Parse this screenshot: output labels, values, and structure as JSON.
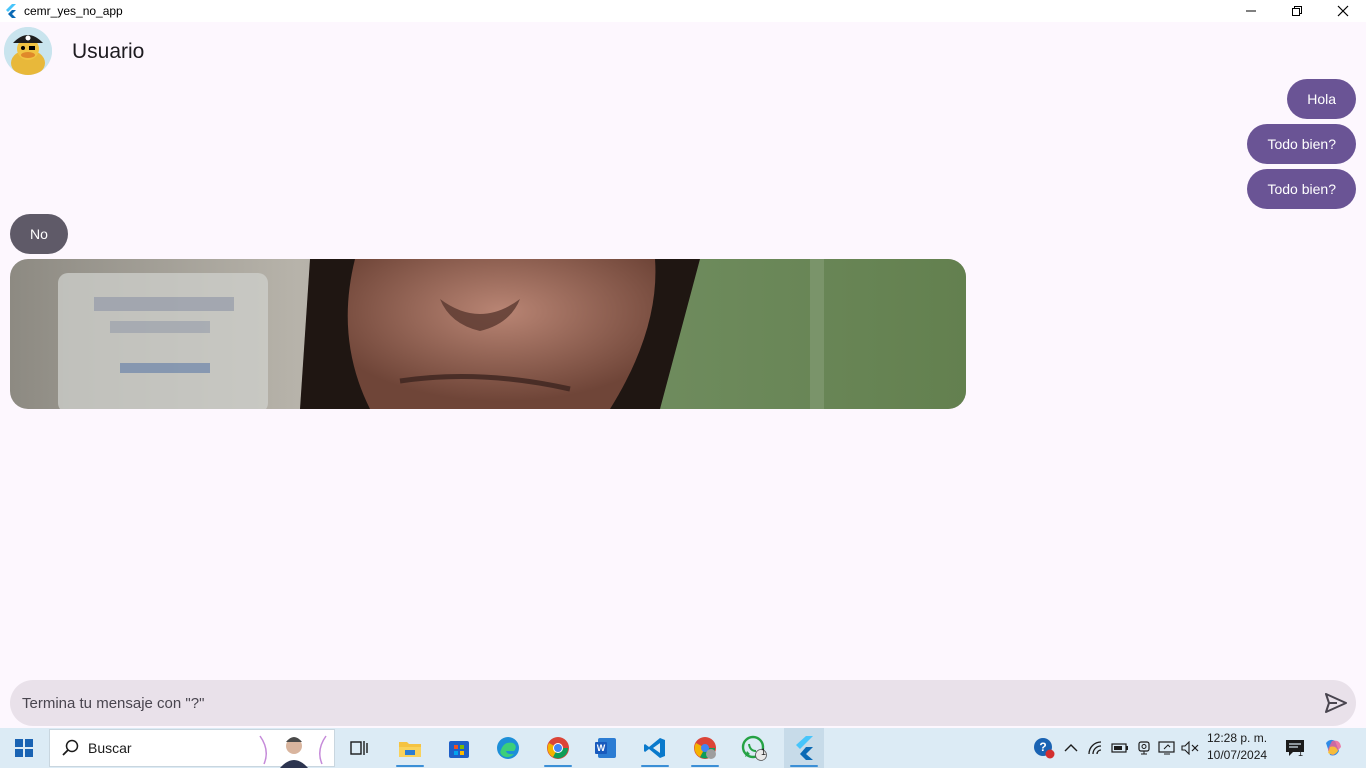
{
  "window": {
    "title": "cemr_yes_no_app",
    "icon": "flutter-logo-icon",
    "controls": [
      "minimize-icon",
      "restore-icon",
      "close-icon"
    ]
  },
  "appbar": {
    "title": "Usuario",
    "avatar": "pirate-duck-avatar"
  },
  "messages": [
    {
      "from": "me",
      "text": "Hola"
    },
    {
      "from": "me",
      "text": "Todo bien?"
    },
    {
      "from": "me",
      "text": "Todo bien?"
    },
    {
      "from": "her",
      "text": "No",
      "image": "gif-image"
    }
  ],
  "input": {
    "placeholder": "Termina tu mensaje con \"?\"",
    "value": "",
    "send_icon": "send-icon"
  },
  "taskbar": {
    "search_label": "Buscar",
    "apps": [
      "windows-start-icon",
      "search-icon",
      "task-view-icon",
      "file-explorer-icon",
      "microsoft-store-icon",
      "edge-icon",
      "chrome-icon",
      "word-icon",
      "vscode-icon",
      "chrome-profile-icon",
      "whatsapp-icon",
      "flutter-icon"
    ],
    "whatsapp_badge": "1",
    "notification_badge": "1",
    "time": "12:28 p. m.",
    "date": "10/07/2024"
  },
  "colors": {
    "background": "#fdf7fe",
    "my_bubble": "#6a5495",
    "her_bubble": "#5f5a68",
    "input_bg": "#e9e1ea",
    "taskbar": "#dcebf5"
  }
}
